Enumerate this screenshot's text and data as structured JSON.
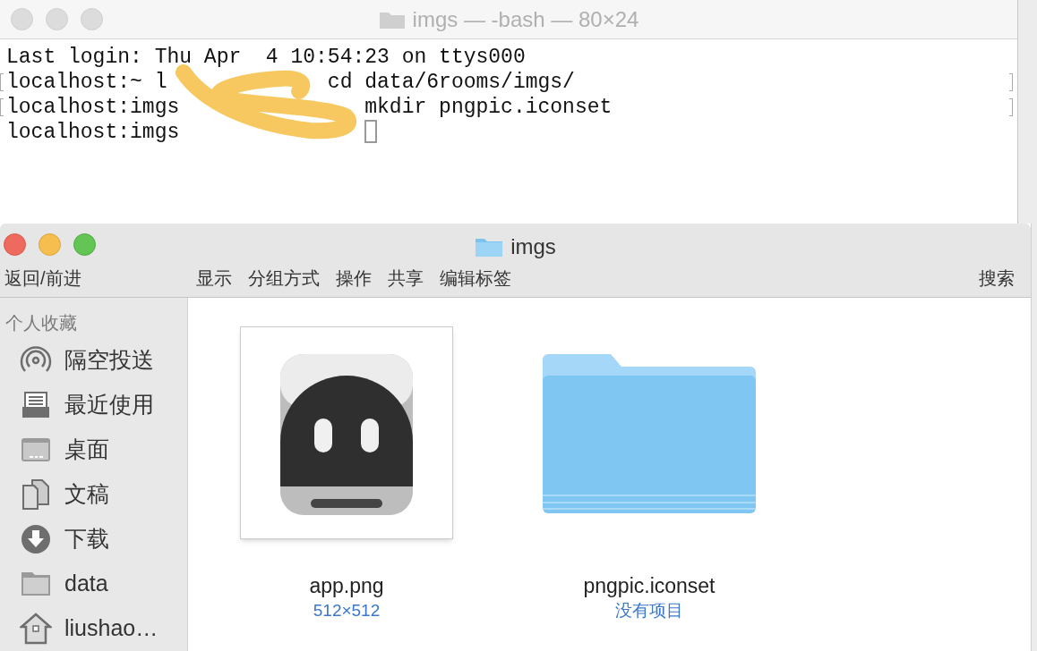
{
  "terminal": {
    "title": "imgs — -bash — 80×24",
    "active": false,
    "lines": [
      {
        "before": "Last login: Thu Apr  4 10:54:23 on ttys000"
      },
      {
        "before": "localhost:~ l",
        "after": "cd data/6rooms/imgs/",
        "marked": true
      },
      {
        "before": "localhost:imgs",
        "after": "mkdir pngpic.iconset",
        "marked": true
      },
      {
        "before": "localhost:imgs",
        "cursor": true
      }
    ]
  },
  "finder": {
    "title": "imgs",
    "active": true,
    "nav": "返回/前进",
    "toolbar": [
      "显示",
      "分组方式",
      "操作",
      "共享",
      "编辑标签"
    ],
    "search": "搜索",
    "sidebar": {
      "heading": "个人收藏",
      "items": [
        {
          "label": "隔空投送",
          "kind": "airdrop"
        },
        {
          "label": "最近使用",
          "kind": "recent"
        },
        {
          "label": "桌面",
          "kind": "desktop"
        },
        {
          "label": "文稿",
          "kind": "documents"
        },
        {
          "label": "下载",
          "kind": "downloads"
        },
        {
          "label": "data",
          "kind": "folder"
        },
        {
          "label": "liushao…",
          "kind": "home"
        }
      ]
    },
    "files": [
      {
        "name": "app.png",
        "info": "512×512",
        "kind": "image"
      },
      {
        "name": "pngpic.iconset",
        "info": "没有项目",
        "kind": "folder"
      }
    ]
  }
}
